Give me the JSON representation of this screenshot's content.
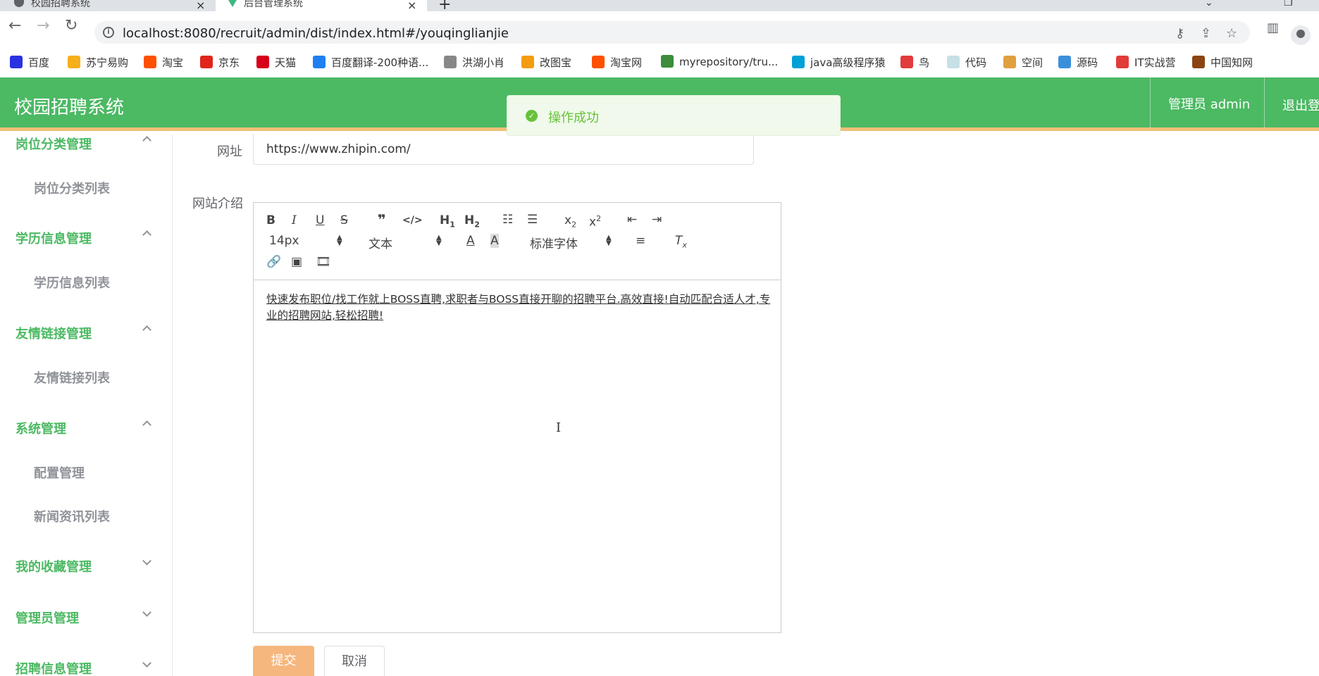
{
  "browser": {
    "tabs": [
      {
        "title": "校园招聘系统",
        "active": false
      },
      {
        "title": "后台管理系统",
        "active": true
      }
    ],
    "new_tab": "+",
    "url": "localhost:8080/recruit/admin/dist/index.html#/youqinglianjie",
    "bookmarks": [
      {
        "label": "百度",
        "color": "#2932e1"
      },
      {
        "label": "苏宁易购",
        "color": "#f5b01b"
      },
      {
        "label": "淘宝",
        "color": "#ff5000"
      },
      {
        "label": "京东",
        "color": "#e1251b"
      },
      {
        "label": "天猫",
        "color": "#d7001a"
      },
      {
        "label": "百度翻译-200种语...",
        "color": "#1e7ff0"
      },
      {
        "label": "洪湖小肖",
        "color": "#888888"
      },
      {
        "label": "改图宝",
        "color": "#f39c12"
      },
      {
        "label": "淘宝网",
        "color": "#ff5000"
      },
      {
        "label": "myrepository/tru...",
        "color": "#3c8d3c"
      },
      {
        "label": "java高级程序猿",
        "color": "#00a1d6"
      },
      {
        "label": "鸟",
        "color": "#e23b3b"
      },
      {
        "label": "代码",
        "color": "#c7dfe6"
      },
      {
        "label": "空间",
        "color": "#e0a040"
      },
      {
        "label": "源码",
        "color": "#3b8fd9"
      },
      {
        "label": "IT实战营",
        "color": "#e23b3b"
      },
      {
        "label": "中国知网",
        "color": "#8b4513"
      }
    ]
  },
  "header": {
    "title": "校园招聘系统",
    "user": "管理员 admin",
    "logout": "退出登"
  },
  "toast": {
    "message": "操作成功",
    "color": "#67c23a"
  },
  "sidebar": {
    "groups": [
      {
        "label": "岗位分类管理",
        "expanded": true,
        "items": [
          "岗位分类列表"
        ]
      },
      {
        "label": "学历信息管理",
        "expanded": true,
        "items": [
          "学历信息列表"
        ]
      },
      {
        "label": "友情链接管理",
        "expanded": true,
        "items": [
          "友情链接列表"
        ]
      },
      {
        "label": "系统管理",
        "expanded": true,
        "items": [
          "配置管理",
          "新闻资讯列表"
        ]
      },
      {
        "label": "我的收藏管理",
        "expanded": false,
        "items": []
      },
      {
        "label": "管理员管理",
        "expanded": false,
        "items": []
      },
      {
        "label": "招聘信息管理",
        "expanded": false,
        "items": []
      }
    ],
    "accent": "#4cb963"
  },
  "form": {
    "url_label": "网址",
    "url_value": "https://www.zhipin.com/",
    "intro_label": "网站介绍",
    "editor": {
      "font_size": "14px",
      "block_type": "文本",
      "font_family": "标准字体",
      "content": "快速发布职位/找工作就上BOSS直聘,求职者与BOSS直接开聊的招聘平台.高效直接!自动匹配合适人才,专业的招聘网站,轻松招聘!"
    },
    "submit_label": "提交",
    "cancel_label": "取消"
  }
}
